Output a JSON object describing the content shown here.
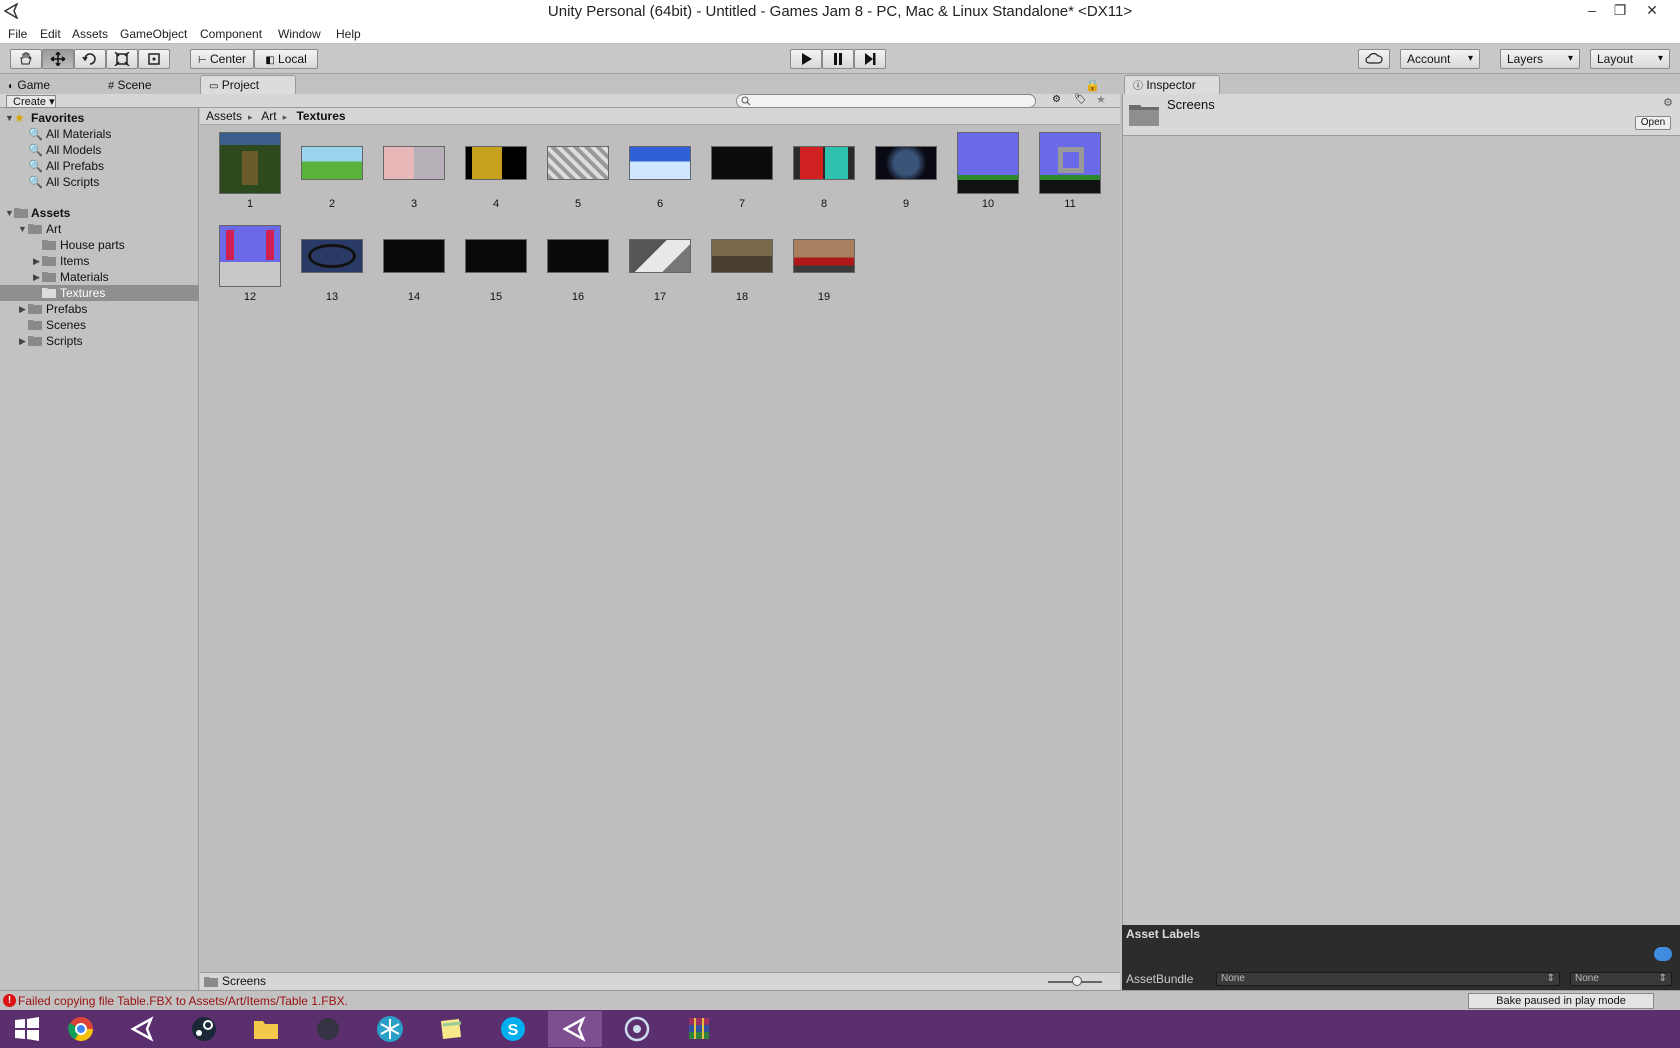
{
  "window": {
    "title": "Unity Personal (64bit) - Untitled - Games Jam 8 - PC, Mac & Linux Standalone* <DX11>",
    "controls": [
      "minimize",
      "restore",
      "close"
    ]
  },
  "menu": [
    "File",
    "Edit",
    "Assets",
    "GameObject",
    "Component",
    "Window",
    "Help"
  ],
  "toolbar": {
    "tools": [
      "hand-tool",
      "move-tool",
      "rotate-tool",
      "scale-tool",
      "rect-tool"
    ],
    "pivot": "Center",
    "space": "Local",
    "play": "play",
    "pause": "pause",
    "step": "step",
    "account": "Account",
    "layers": "Layers",
    "layout": "Layout"
  },
  "tabs": {
    "game": "Game",
    "scene": "Scene",
    "project": "Project",
    "inspector": "Inspector"
  },
  "project": {
    "create": "Create",
    "search_placeholder": "",
    "breadcrumb": [
      "Assets",
      "Art",
      "Textures"
    ],
    "tree": {
      "favorites": "Favorites",
      "favorite_items": [
        "All Materials",
        "All Models",
        "All Prefabs",
        "All Scripts"
      ],
      "assets": "Assets",
      "art": "Art",
      "art_children": [
        "House parts",
        "Items",
        "Materials",
        "Textures"
      ],
      "other_folders": [
        "Prefabs",
        "Scenes",
        "Scripts"
      ]
    },
    "thumbnails": [
      "1",
      "2",
      "3",
      "4",
      "5",
      "6",
      "7",
      "8",
      "9",
      "10",
      "11",
      "12",
      "13",
      "14",
      "15",
      "16",
      "17",
      "18",
      "19"
    ],
    "footer_path": "Screens"
  },
  "inspector": {
    "name": "Screens",
    "open": "Open",
    "asset_labels": "Asset Labels",
    "asset_bundle_label": "AssetBundle",
    "asset_bundle_value": "None",
    "asset_bundle_variant": "None"
  },
  "status": {
    "message": "Failed copying file Table.FBX to Assets/Art/Items/Table 1.FBX.",
    "bake": "Bake paused in play mode"
  },
  "taskbar": [
    "windows-start",
    "chrome",
    "unity",
    "steam",
    "file-explorer",
    "app-moon",
    "app-snow",
    "sticky-notes",
    "skype",
    "unity-active",
    "media-app",
    "winrar"
  ]
}
